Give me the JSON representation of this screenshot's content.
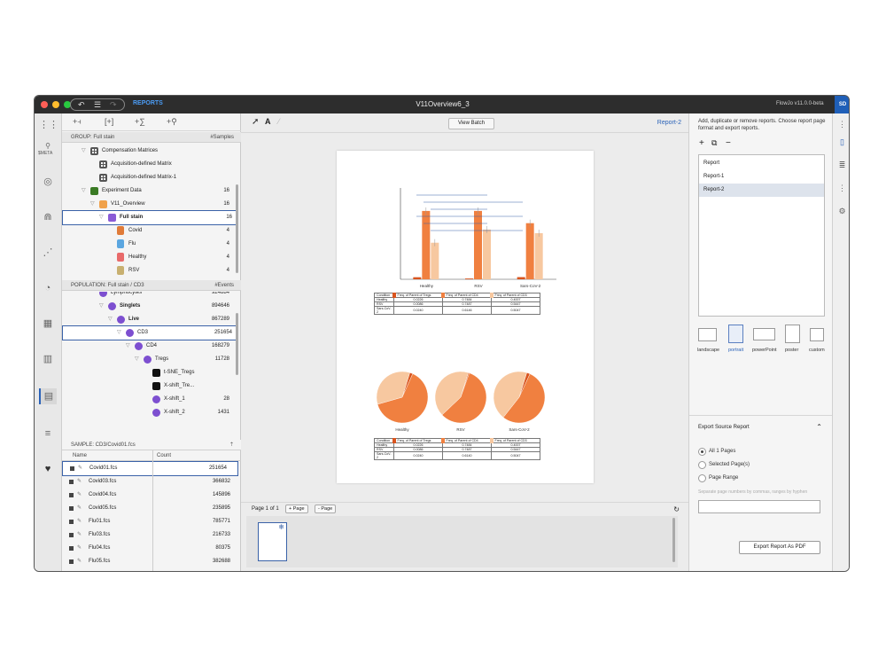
{
  "titlebar": {
    "reports_link": "REPORTS",
    "title": "V11Overview6_3",
    "version": "FlowJo v11.0.0-beta",
    "avatar": "SD"
  },
  "left_rail": {
    "meta_label": "$META"
  },
  "workspace": {
    "group_header": "GROUP: Full stain",
    "group_col": "#Samples",
    "tree": [
      {
        "label": "Compensation Matrices",
        "count": ""
      },
      {
        "label": "Acquisition-defined Matrix",
        "count": ""
      },
      {
        "label": "Acquisition-defined Matrix-1",
        "count": ""
      },
      {
        "label": "Experiment Data",
        "count": "16"
      },
      {
        "label": "V11_Overview",
        "count": "16"
      },
      {
        "label": "Full stain",
        "count": "16"
      },
      {
        "label": "Covid",
        "count": "4"
      },
      {
        "label": "Flu",
        "count": "4"
      },
      {
        "label": "Healthy",
        "count": "4"
      },
      {
        "label": "RSV",
        "count": "4"
      }
    ],
    "population_header": "POPULATION: Full stain / CD3",
    "population_col": "#Events",
    "populations": [
      {
        "label": "Lymphocytes",
        "count": "924884"
      },
      {
        "label": "Singlets",
        "count": "894646"
      },
      {
        "label": "Live",
        "count": "867289"
      },
      {
        "label": "CD3",
        "count": "251654"
      },
      {
        "label": "CD4",
        "count": "168279"
      },
      {
        "label": "Tregs",
        "count": "11728"
      },
      {
        "label": "t-SNE_Tregs",
        "count": ""
      },
      {
        "label": "X-shift_Tre...",
        "count": ""
      },
      {
        "label": "X-shift_1",
        "count": "28"
      },
      {
        "label": "X-shift_2",
        "count": "1431"
      }
    ],
    "sample_header": "SAMPLE: CD3/Covid01.fcs",
    "col_name": "Name",
    "col_count": "Count",
    "samples": [
      {
        "name": "Covid01.fcs",
        "count": "251654"
      },
      {
        "name": "Covid03.fcs",
        "count": "366832"
      },
      {
        "name": "Covid04.fcs",
        "count": "145896"
      },
      {
        "name": "Covid05.fcs",
        "count": "235895"
      },
      {
        "name": "Flu01.fcs",
        "count": "785771"
      },
      {
        "name": "Flu03.fcs",
        "count": "216733"
      },
      {
        "name": "Flu04.fcs",
        "count": "80375"
      },
      {
        "name": "Flu05.fcs",
        "count": "382688"
      }
    ]
  },
  "center": {
    "view_batch": "View Batch",
    "report_name": "Report-2",
    "page_info": "Page 1 of 1",
    "add_page": "+ Page",
    "remove_page": "- Page"
  },
  "chart_data": [
    {
      "type": "bar",
      "categories": [
        "Healthy",
        "RSV",
        "Sars-CoV-2"
      ],
      "series": [
        {
          "name": "Freq. of Parent of Tregs",
          "values": [
            0.0226,
            0.0086,
            0.024
          ]
        },
        {
          "name": "Freq. of Parent of CD4",
          "values": [
            0.7484,
            0.7487,
            0.6146
          ]
        },
        {
          "name": "Freq. of Parent of CD3",
          "values": [
            0.4007,
            0.5447,
            0.5047
          ]
        }
      ],
      "colors": [
        "#d9541e",
        "#f08040",
        "#f7c8a0"
      ]
    },
    {
      "type": "table",
      "columns": [
        "Condition",
        "Freq. of Parent of Tregs",
        "Freq. of Parent of CD4",
        "Freq. of Parent of CD3"
      ],
      "rows": [
        [
          "Healthy",
          "0.0226",
          "0.7484",
          "0.4007"
        ],
        [
          "RSV",
          "0.0086",
          "0.7487",
          "0.5447"
        ],
        [
          "Sars-CoV-2",
          "0.0240",
          "0.6146",
          "0.5047"
        ]
      ]
    },
    {
      "type": "pie",
      "categories": [
        "Healthy",
        "RSV",
        "Sars-CoV-2"
      ],
      "slices": [
        {
          "name": "Freq. of Parent of Tregs",
          "values": [
            0.0226,
            0.0086,
            0.024
          ]
        },
        {
          "name": "Freq. of Parent of CD4",
          "values": [
            0.7484,
            0.7487,
            0.6146
          ]
        },
        {
          "name": "Freq. of Parent of CD3",
          "values": [
            0.4007,
            0.5447,
            0.5047
          ]
        }
      ]
    },
    {
      "type": "table",
      "columns": [
        "Condition",
        "Freq. of Parent of Tregs",
        "Freq. of Parent of CD4",
        "Freq. of Parent of CD3"
      ],
      "rows": [
        [
          "Healthy",
          "0.0226",
          "0.7484",
          "0.4007"
        ],
        [
          "RSV",
          "0.0086",
          "0.7487",
          "0.5447"
        ],
        [
          "Sars-CoV-2",
          "0.0240",
          "0.6140",
          "0.5047"
        ]
      ]
    }
  ],
  "right_panel": {
    "description": "Add, duplicate or remove reports. Choose report page format and export reports.",
    "reports": [
      "Report",
      "Report-1",
      "Report-2"
    ],
    "formats": [
      "landscape",
      "portrait",
      "powerPoint",
      "poster",
      "custom"
    ],
    "export_header": "Export Source Report",
    "options": [
      "All 1 Pages",
      "Selected Page(s)",
      "Page Range"
    ],
    "range_placeholder": "Separate page numbers by commas, ranges by hyphen",
    "export_button": "Export Report As PDF"
  }
}
